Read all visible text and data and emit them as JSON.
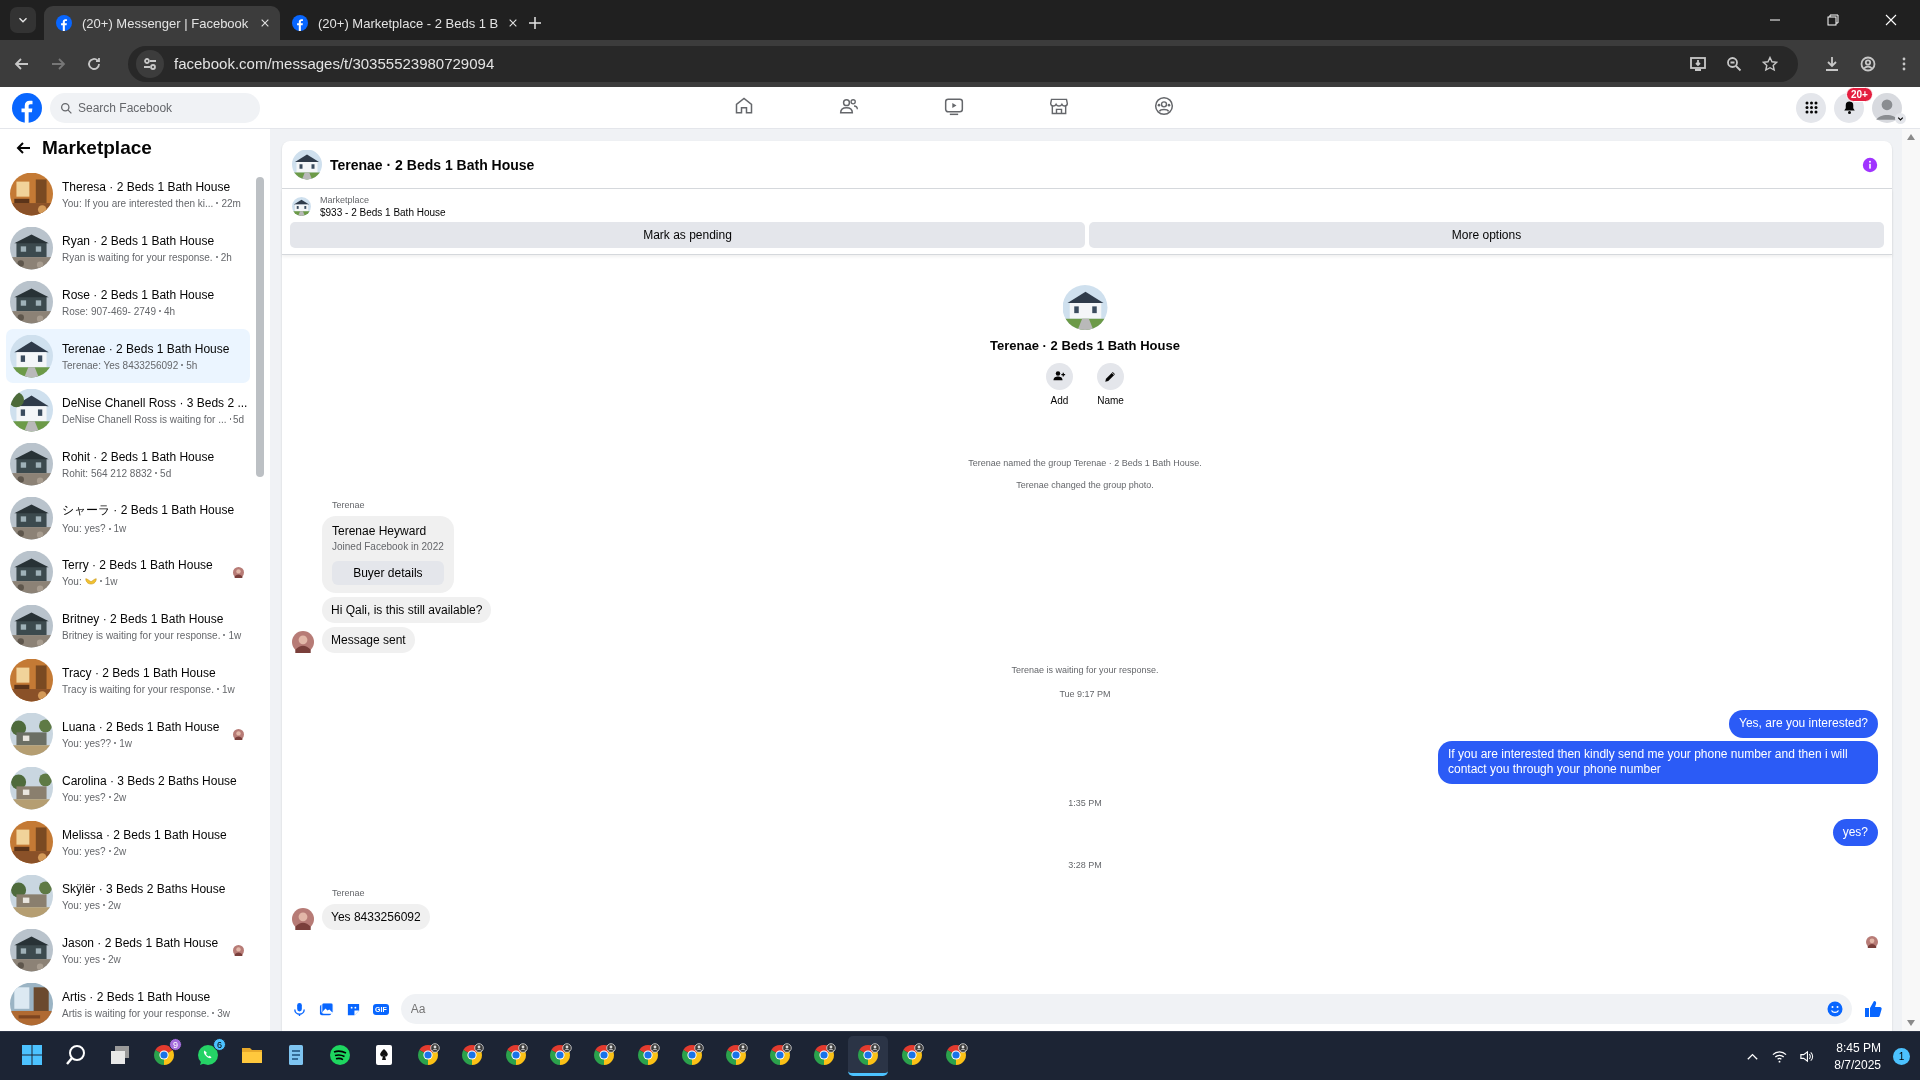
{
  "browser": {
    "tabs": [
      {
        "title": "(20+) Messenger | Facebook",
        "selected": true
      },
      {
        "title": "(20+) Marketplace - 2 Beds 1 B",
        "selected": false
      }
    ],
    "url": "facebook.com/messages/t/30355523980729094"
  },
  "facebook_header": {
    "search": {
      "placeholder": "Search Facebook"
    },
    "nav": [
      {
        "kind": "home"
      },
      {
        "kind": "friends"
      },
      {
        "kind": "video"
      },
      {
        "kind": "marketplace"
      },
      {
        "kind": "groups"
      }
    ],
    "notification_badge": "20+"
  },
  "sidebar": {
    "title": "Marketplace",
    "items": [
      {
        "title": "Theresa · 2 Beds 1 Bath House",
        "preview": "You: If you are interested then ki...",
        "time": "22m",
        "selected": false,
        "seen": false
      },
      {
        "title": "Ryan · 2 Beds 1 Bath House",
        "preview": "Ryan is waiting for your response.",
        "time": "2h",
        "selected": false,
        "seen": false
      },
      {
        "title": "Rose · 2 Beds 1 Bath House",
        "preview": "Rose: 907-469- 2749",
        "time": "4h",
        "selected": false,
        "seen": false
      },
      {
        "title": "Terenae · 2 Beds 1 Bath House",
        "preview": "Terenae: Yes 8433256092",
        "time": "5h",
        "selected": true,
        "seen": false
      },
      {
        "title": "DeNise Chanell Ross · 3 Beds 2 ...",
        "preview": "DeNise Chanell Ross is waiting for ...",
        "time": "5d",
        "selected": false,
        "seen": false
      },
      {
        "title": "Rohit · 2 Beds 1 Bath House",
        "preview": "Rohit: 564 212 8832",
        "time": "5d",
        "selected": false,
        "seen": false
      },
      {
        "title": "シャーラ · 2 Beds 1 Bath House",
        "preview": "You: yes?",
        "time": "1w",
        "selected": false,
        "seen": false
      },
      {
        "title": "Terry · 2 Beds 1 Bath House",
        "preview": "You:",
        "time": "1w",
        "selected": false,
        "seen": true,
        "reaction_icon": true
      },
      {
        "title": "Britney · 2 Beds 1 Bath House",
        "preview": "Britney is waiting for your response.",
        "time": "1w",
        "selected": false,
        "seen": false
      },
      {
        "title": "Tracy · 2 Beds 1 Bath House",
        "preview": "Tracy is waiting for your response.",
        "time": "1w",
        "selected": false,
        "seen": false
      },
      {
        "title": "Luana · 2 Beds 1 Bath House",
        "preview": "You: yes??",
        "time": "1w",
        "selected": false,
        "seen": true
      },
      {
        "title": "Carolina · 3 Beds 2 Baths House",
        "preview": "You: yes?",
        "time": "2w",
        "selected": false,
        "seen": false
      },
      {
        "title": "Melissa · 2 Beds 1 Bath House",
        "preview": "You: yes?",
        "time": "2w",
        "selected": false,
        "seen": false
      },
      {
        "title": "Skÿlër · 3 Beds 2 Baths House",
        "preview": "You: yes",
        "time": "2w",
        "selected": false,
        "seen": false
      },
      {
        "title": "Jason · 2 Beds 1 Bath House",
        "preview": "You: yes",
        "time": "2w",
        "selected": false,
        "seen": true
      },
      {
        "title": "Artis · 2 Beds 1 Bath House",
        "preview": "Artis is waiting for your response.",
        "time": "3w",
        "selected": false,
        "seen": false
      }
    ]
  },
  "chat": {
    "title": "Terenae · 2 Beds 1 Bath House",
    "listing": {
      "label": "Marketplace",
      "item": "$933 - 2 Beds 1 Bath House",
      "buttons": [
        "Mark as pending",
        "More options"
      ]
    },
    "intro": {
      "title": "Terenae · 2 Beds 1 Bath House",
      "actions": [
        {
          "kind": "add",
          "label": "Add"
        },
        {
          "kind": "name",
          "label": "Name"
        }
      ]
    },
    "timeline": [
      {
        "kind": "notice",
        "text": "Terenae named the group Terenae · 2 Beds 1 Bath House."
      },
      {
        "kind": "notice",
        "text": "Terenae changed the group photo."
      },
      {
        "kind": "sender",
        "text": "Terenae"
      },
      {
        "kind": "card",
        "name": "Terenae Heyward",
        "detail": "Joined Facebook in 2022",
        "button": "Buyer details"
      },
      {
        "kind": "incoming",
        "text": "Hi Qali, is this still available?",
        "avatar": false
      },
      {
        "kind": "incoming",
        "text": "Message sent",
        "avatar": true
      },
      {
        "kind": "notice",
        "text": "Terenae is waiting for your response."
      },
      {
        "kind": "time",
        "text": "Tue 9:17 PM"
      },
      {
        "kind": "outgoing",
        "text": "Yes, are you interested?"
      },
      {
        "kind": "outgoing",
        "text": "If you are interested then kindly send me your phone number and then i will contact you through your phone number"
      },
      {
        "kind": "time",
        "text": "1:35 PM"
      },
      {
        "kind": "outgoing",
        "text": "yes?"
      },
      {
        "kind": "time",
        "text": "3:28 PM"
      },
      {
        "kind": "sender",
        "text": "Terenae"
      },
      {
        "kind": "incoming",
        "text": "Yes 8433256092",
        "avatar": true
      },
      {
        "kind": "seen"
      }
    ],
    "composer": {
      "placeholder": "Aa",
      "gif_label": "GIF"
    }
  },
  "taskbar": {
    "items": [
      {
        "kind": "start",
        "selected": false
      },
      {
        "kind": "search",
        "selected": false
      },
      {
        "kind": "taskview",
        "selected": false
      },
      {
        "kind": "chrome",
        "selected": false,
        "badge": "9"
      },
      {
        "kind": "whatsapp",
        "selected": false,
        "badge": "6"
      },
      {
        "kind": "files",
        "selected": false
      },
      {
        "kind": "notepad",
        "selected": false
      },
      {
        "kind": "spotify",
        "selected": false
      },
      {
        "kind": "cards",
        "selected": false
      },
      {
        "kind": "chrome",
        "selected": false
      },
      {
        "kind": "chrome",
        "selected": false
      },
      {
        "kind": "chrome",
        "selected": false
      },
      {
        "kind": "chrome",
        "selected": false
      },
      {
        "kind": "chrome",
        "selected": false
      },
      {
        "kind": "chrome",
        "selected": false
      },
      {
        "kind": "chrome",
        "selected": false
      },
      {
        "kind": "chrome",
        "selected": false
      },
      {
        "kind": "chrome",
        "selected": false
      },
      {
        "kind": "chrome",
        "selected": false
      },
      {
        "kind": "chrome",
        "selected": true
      },
      {
        "kind": "chrome",
        "selected": false
      },
      {
        "kind": "chrome",
        "selected": false
      }
    ],
    "time": "8:45 PM",
    "date": "8/7/2025",
    "notifications": "1"
  }
}
